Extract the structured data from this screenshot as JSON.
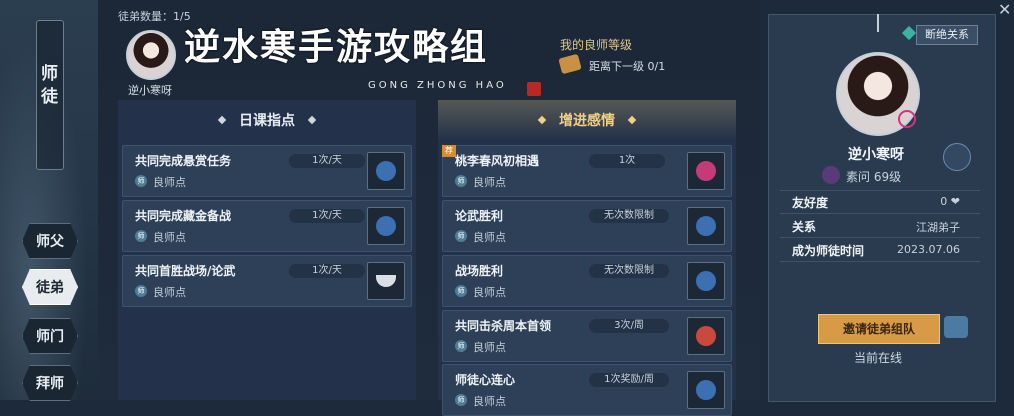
{
  "header": {
    "disciple_count": "徒弟数量：1/5",
    "watermark": "逆水寒手游攻略组",
    "watermark_sub": "GONG ZHONG HAO"
  },
  "current_student": {
    "name": "逆小寒呀"
  },
  "level": {
    "title": "我的良师等级",
    "next": "距离下一级 0/1"
  },
  "left_nav": {
    "title": "师徒",
    "items": [
      {
        "label": "师父",
        "active": false
      },
      {
        "label": "徒弟",
        "active": true
      },
      {
        "label": "师门",
        "active": false
      },
      {
        "label": "拜师",
        "active": false
      }
    ]
  },
  "daily": {
    "header": "日课指点",
    "tasks": [
      {
        "name": "共同完成悬赏任务",
        "limit": "1次/天",
        "reward": "良师点",
        "icon": "bag-icon",
        "color": "#3d6fb3"
      },
      {
        "name": "共同完成藏金备战",
        "limit": "1次/天",
        "reward": "良师点",
        "icon": "bag-icon",
        "color": "#3d6fb3"
      },
      {
        "name": "共同首胜战场/论武",
        "limit": "1次/天",
        "reward": "良师点",
        "icon": "bowl-icon",
        "color": "#d9dfe4"
      }
    ]
  },
  "bond": {
    "header": "增进感情",
    "tasks": [
      {
        "name": "桃李春风初相遇",
        "limit": "1次",
        "reward": "良师点",
        "icon": "flower-gift-icon",
        "color": "#c43b7a",
        "badge": "荐"
      },
      {
        "name": "论武胜利",
        "limit": "无次数限制",
        "reward": "良师点",
        "icon": "bag-icon",
        "color": "#3d6fb3"
      },
      {
        "name": "战场胜利",
        "limit": "无次数限制",
        "reward": "良师点",
        "icon": "bag-icon",
        "color": "#3d6fb3"
      },
      {
        "name": "共同击杀周本首领",
        "limit": "3次/周",
        "reward": "良师点",
        "icon": "bowl-icon",
        "color": "#c94a3c"
      },
      {
        "name": "师徒心连心",
        "limit": "1次奖励/周",
        "reward": "良师点",
        "icon": "bag-icon",
        "color": "#3d6fb3"
      }
    ]
  },
  "profile": {
    "break_label": "断绝关系",
    "name": "逆小寒呀",
    "level": "素问  69级",
    "rows": [
      {
        "label": "友好度",
        "value": "0 ❤"
      },
      {
        "label": "关系",
        "value": "江湖弟子"
      },
      {
        "label": "成为师徒时间",
        "value": "2023.07.06"
      }
    ],
    "invite_label": "邀请徒弟组队",
    "status": "当前在线"
  },
  "colors": {
    "accent_gold": "#d79b48",
    "panel": "#23324a"
  }
}
